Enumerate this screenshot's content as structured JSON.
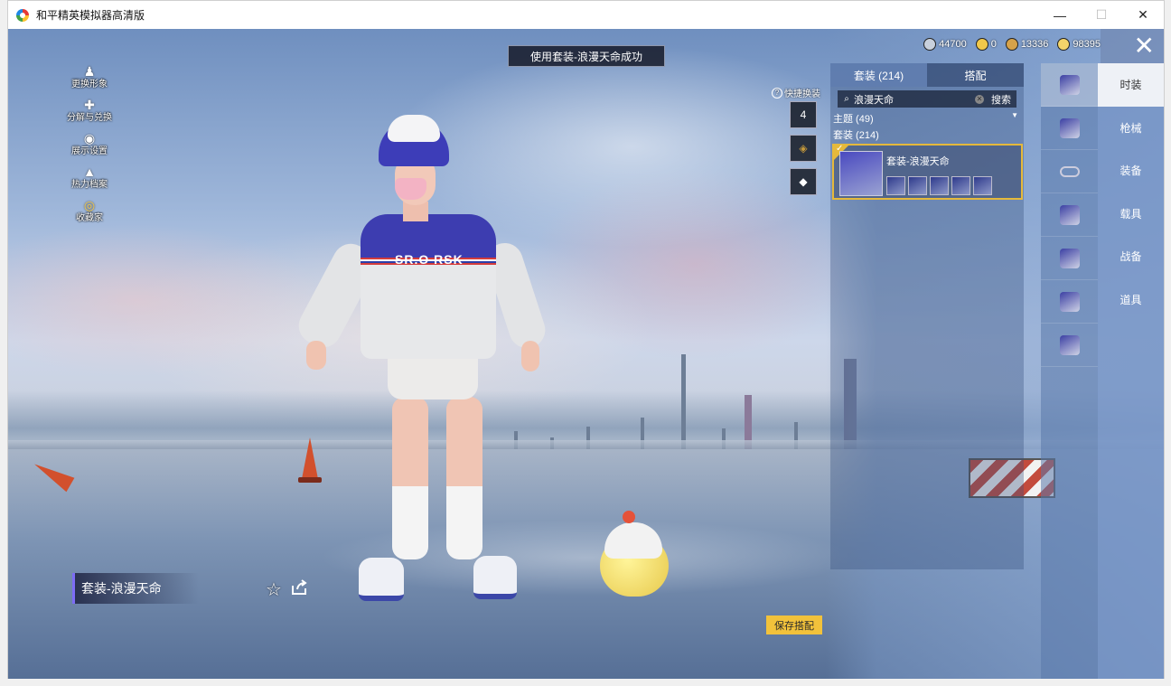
{
  "window": {
    "title": "和平精英模拟器高清版",
    "controls": {
      "minimize": "—",
      "maximize": "☐",
      "close": "✕"
    }
  },
  "toast": "使用套装-浪漫天命成功",
  "currencies": [
    {
      "value": "44700",
      "color": "#c8d0dc",
      "icon": "coin-icon"
    },
    {
      "value": "0",
      "color": "#f1c84a",
      "icon": "medal-icon"
    },
    {
      "value": "13336",
      "color": "#d6a24a",
      "icon": "badge-icon"
    },
    {
      "value": "98395",
      "color": "#f3d46a",
      "icon": "gold-coin-icon"
    }
  ],
  "side_menu": [
    {
      "label": "更换形象",
      "icon": "avatar-icon",
      "glyph": "♟"
    },
    {
      "label": "分解与兑换",
      "icon": "gear-puzzle-icon",
      "glyph": "✚"
    },
    {
      "label": "展示设置",
      "icon": "eye-icon",
      "glyph": "◉"
    },
    {
      "label": "热力档案",
      "icon": "flame-icon",
      "glyph": "▲"
    },
    {
      "label": "收藏家",
      "icon": "collector-icon",
      "glyph": "◎"
    }
  ],
  "quick_change": {
    "label": "快捷换装",
    "slots": [
      "4",
      "",
      ""
    ]
  },
  "panel": {
    "tabs": [
      "套装 (214)",
      "搭配"
    ],
    "search": {
      "value": "浪漫天命",
      "button": "搜索"
    },
    "theme_label": "主题 (49)",
    "outfit_label": "套装 (214)",
    "item": {
      "name": "套装-浪漫天命"
    }
  },
  "category_tabs": [
    "时装",
    "枪械",
    "装备",
    "载具",
    "战备",
    "道具"
  ],
  "bottom": {
    "outfit_name": "套装-浪漫天命",
    "save_button": "保存搭配"
  },
  "character": {
    "jacket_text": "SR.O   RSK"
  }
}
